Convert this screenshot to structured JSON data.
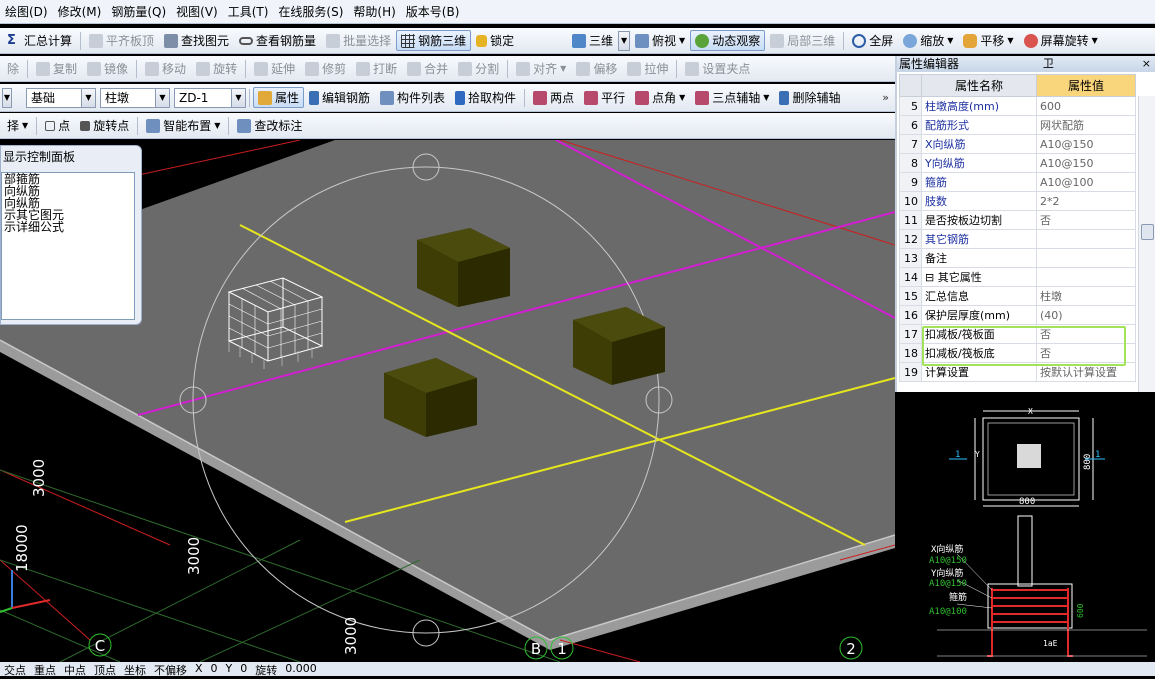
{
  "menu": [
    "绘图(D)",
    "修改(M)",
    "钢筋量(Q)",
    "视图(V)",
    "工具(T)",
    "在线服务(S)",
    "帮助(H)",
    "版本号(B)"
  ],
  "toolbar1": {
    "left": [
      "汇总计算",
      "平齐板顶",
      "查找图元",
      "查看钢筋量",
      "批量选择",
      "钢筋三维",
      "锁定"
    ],
    "right": [
      "三维",
      "俯视",
      "动态观察",
      "局部三维",
      "全屏",
      "缩放",
      "平移",
      "屏幕旋转"
    ]
  },
  "toolbar2": [
    "除",
    "复制",
    "镜像",
    "移动",
    "旋转",
    "延伸",
    "修剪",
    "打断",
    "合并",
    "分割",
    "对齐",
    "偏移",
    "拉伸",
    "设置夹点"
  ],
  "toolbar3": {
    "combos": [
      "基础",
      "柱墩",
      "ZD-1"
    ],
    "buttons": [
      "属性",
      "编辑钢筋",
      "构件列表",
      "拾取构件",
      "两点",
      "平行",
      "点角",
      "三点辅轴",
      "删除辅轴"
    ]
  },
  "toolbar4": [
    "择",
    "点",
    "旋转点",
    "智能布置",
    "查改标注"
  ],
  "panel": {
    "title": "显示控制面板",
    "items": [
      "部箍筋",
      "向纵筋",
      "向纵筋",
      "示其它图元",
      "示详细公式"
    ]
  },
  "viewport": {
    "dims": [
      "3000",
      "18000",
      "3000",
      "3000"
    ],
    "axes": [
      "C",
      "B",
      "1",
      "2"
    ]
  },
  "property_editor": {
    "title": "属性编辑器",
    "pin": "卫",
    "close": "×",
    "col_name": "属性名称",
    "col_value": "属性值",
    "rows": [
      {
        "num": "5",
        "name": "柱墩高度(mm)",
        "value": "600",
        "blue": true
      },
      {
        "num": "6",
        "name": "配筋形式",
        "value": "网状配筋",
        "blue": true
      },
      {
        "num": "7",
        "name": "X向纵筋",
        "value": "A10@150",
        "blue": true
      },
      {
        "num": "8",
        "name": "Y向纵筋",
        "value": "A10@150",
        "blue": true
      },
      {
        "num": "9",
        "name": "箍筋",
        "value": "A10@100",
        "blue": true
      },
      {
        "num": "10",
        "name": "肢数",
        "value": "2*2",
        "blue": true
      },
      {
        "num": "11",
        "name": "是否按板边切割",
        "value": "否",
        "blue": false
      },
      {
        "num": "12",
        "name": "其它钢筋",
        "value": "",
        "blue": true
      },
      {
        "num": "13",
        "name": "备注",
        "value": "",
        "blue": false
      },
      {
        "num": "14",
        "name": "⊟ 其它属性",
        "value": "",
        "blue": false
      },
      {
        "num": "15",
        "name": "汇总信息",
        "value": "柱墩",
        "blue": false
      },
      {
        "num": "16",
        "name": "保护层厚度(mm)",
        "value": "(40)",
        "blue": false
      },
      {
        "num": "17",
        "name": "扣减板/筏板面",
        "value": "否",
        "blue": false
      },
      {
        "num": "18",
        "name": "扣减板/筏板底",
        "value": "否",
        "blue": false
      },
      {
        "num": "19",
        "name": "计算设置",
        "value": "按默认计算设置",
        "blue": false
      }
    ]
  },
  "preview": {
    "plan_x": "X",
    "plan_y": "Y",
    "dim_width": "800",
    "dim_height": "800",
    "sec_mark": "1",
    "labels": [
      "X向纵筋",
      "A10@150",
      "Y向纵筋",
      "A10@150",
      "箍筋",
      "A10@100"
    ],
    "dim_600": "600",
    "lae": "1aE",
    "section_title": "1-1",
    "zero": "0"
  },
  "statusbar": [
    "交点",
    "重点",
    "中点",
    "顶点",
    "坐标",
    "不偏移",
    "X",
    "0",
    "Y",
    "0",
    "旋转",
    "0.000"
  ]
}
